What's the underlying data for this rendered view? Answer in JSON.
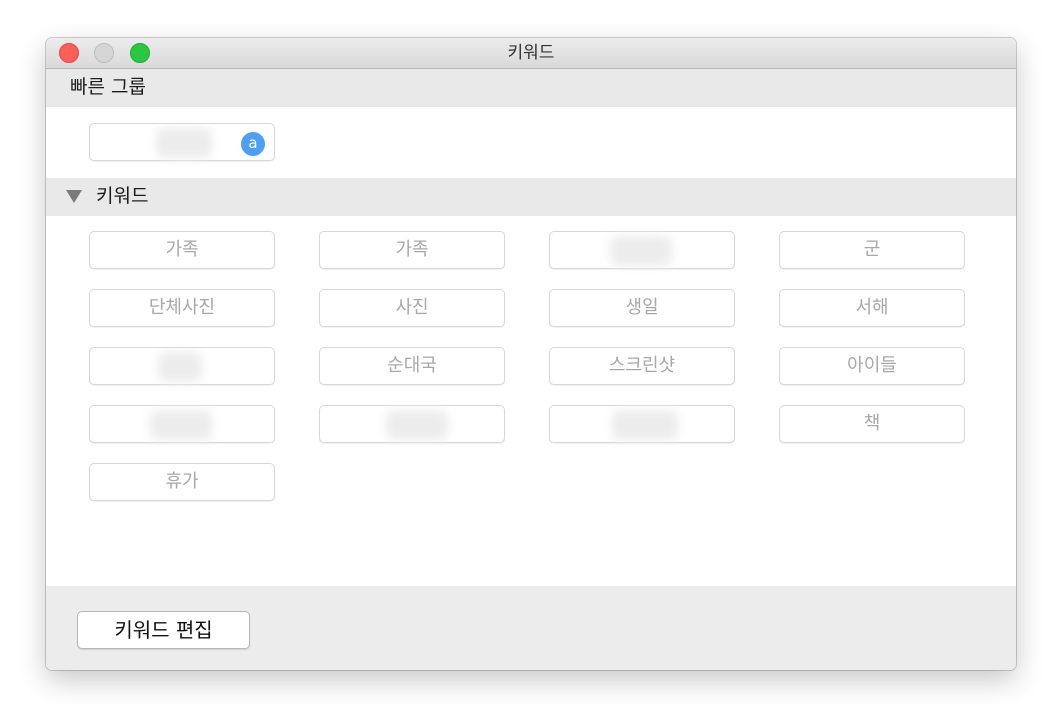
{
  "window": {
    "title": "키워드"
  },
  "quick_group": {
    "header": "빠른 그룹",
    "items": [
      {
        "label": "",
        "shortcut": "a"
      }
    ]
  },
  "keywords": {
    "header": "키워드",
    "items": [
      "가족",
      "가족",
      "",
      "군",
      "단체사진",
      "사진",
      "생일",
      "서해",
      "",
      "순대국",
      "스크린샷",
      "아이들",
      "",
      "",
      "",
      "책",
      "휴가"
    ]
  },
  "footer": {
    "edit_label": "키워드 편집"
  },
  "colors": {
    "close": "#fc5f57",
    "minimize": "#d5d5d5",
    "zoom": "#29c840",
    "shortcut_badge": "#4e9ef5"
  }
}
